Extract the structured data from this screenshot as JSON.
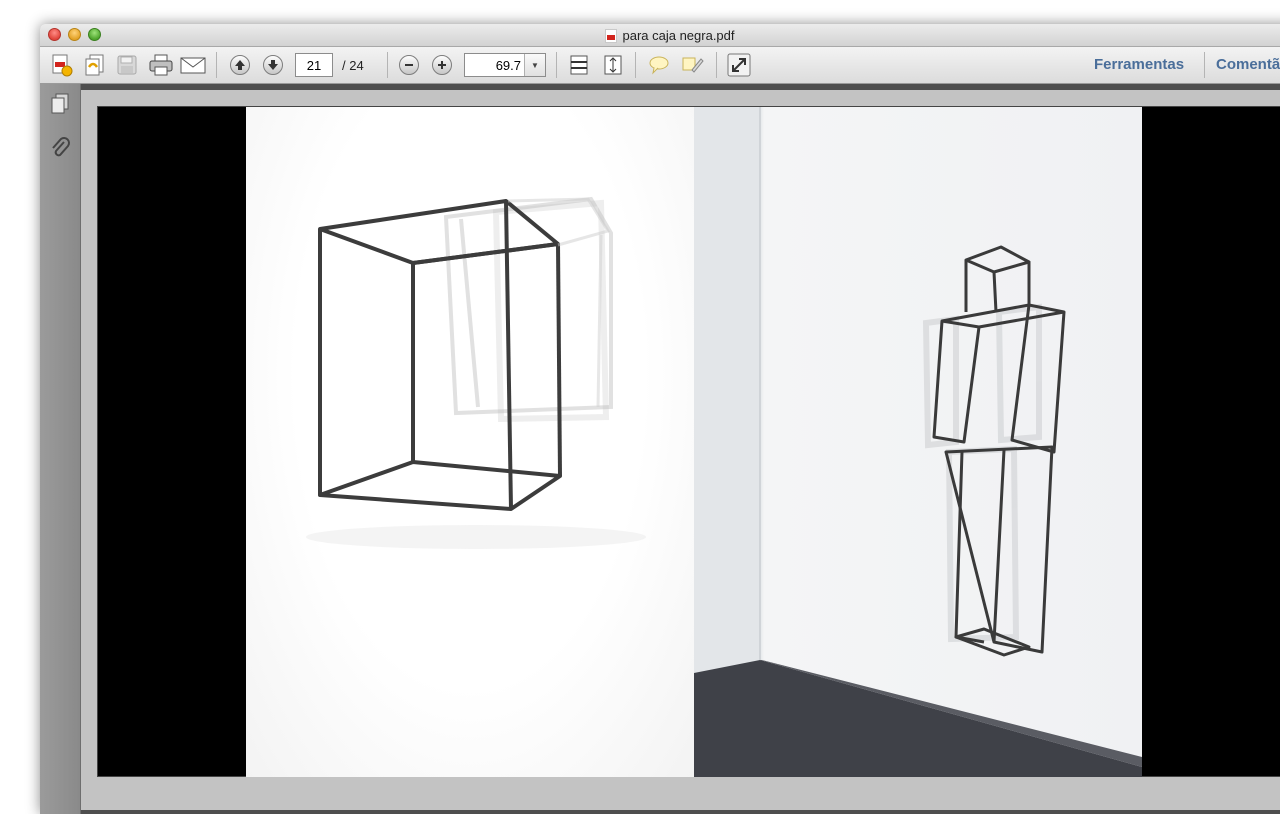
{
  "window": {
    "title": "para caja negra.pdf"
  },
  "toolbar": {
    "page_number": "21",
    "page_total": "/ 24",
    "zoom_value": "69.7",
    "tools_label": "Ferramentas",
    "comment_label": "Comentã"
  },
  "colors": {
    "link_text": "#4a6e9a",
    "document_background": "#000000"
  },
  "icons": [
    "create-pdf-icon",
    "combine-files-icon",
    "save-icon",
    "print-icon",
    "email-icon",
    "previous-page-icon",
    "next-page-icon",
    "zoom-out-icon",
    "zoom-in-icon",
    "fit-width-icon",
    "fit-page-icon",
    "comment-icon",
    "highlight-icon",
    "full-screen-icon",
    "pages-panel-icon",
    "attachments-icon"
  ]
}
